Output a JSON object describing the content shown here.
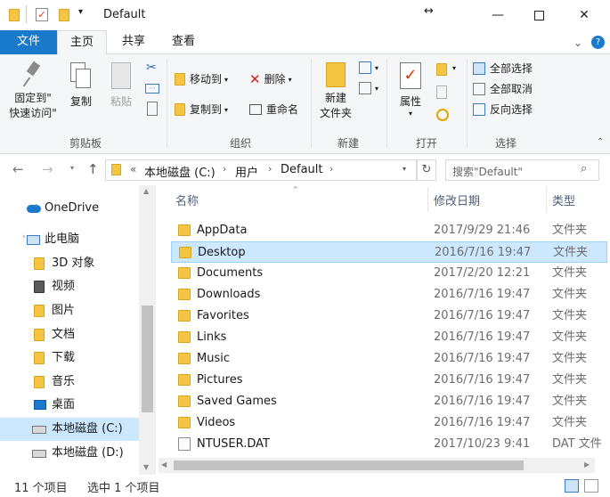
{
  "window": {
    "title": "Default"
  },
  "tabs": [
    "文件",
    "主页",
    "共享",
    "查看"
  ],
  "ribbon": {
    "clipboard": {
      "pin_l1": "固定到\"",
      "pin_l2": "快速访问\"",
      "copy": "复制",
      "paste": "粘贴",
      "group": "剪贴板"
    },
    "organize": {
      "move_to": "移动到",
      "copy_to": "复制到",
      "delete": "删除",
      "rename": "重命名",
      "group": "组织"
    },
    "new": {
      "new_folder_l1": "新建",
      "new_folder_l2": "文件夹",
      "group": "新建"
    },
    "open": {
      "properties": "属性",
      "group": "打开"
    },
    "select": {
      "select_all": "全部选择",
      "select_none": "全部取消",
      "invert": "反向选择",
      "group": "选择"
    }
  },
  "address": {
    "crumbs": [
      "本地磁盘 (C:)",
      "用户",
      "Default"
    ],
    "overflow": "«"
  },
  "search": {
    "placeholder": "搜索\"Default\""
  },
  "nav": {
    "items": [
      {
        "label": "OneDrive",
        "icon": "cloud-icon"
      },
      {
        "label": "此电脑",
        "icon": "computer-icon"
      },
      {
        "label": "3D 对象",
        "icon": "3d-objects-icon"
      },
      {
        "label": "视频",
        "icon": "video-icon"
      },
      {
        "label": "图片",
        "icon": "pictures-icon"
      },
      {
        "label": "文档",
        "icon": "documents-icon"
      },
      {
        "label": "下载",
        "icon": "downloads-icon"
      },
      {
        "label": "音乐",
        "icon": "music-icon"
      },
      {
        "label": "桌面",
        "icon": "desktop-icon"
      },
      {
        "label": "本地磁盘 (C:)",
        "icon": "drive-c-icon"
      },
      {
        "label": "本地磁盘 (D:)",
        "icon": "drive-d-icon"
      }
    ]
  },
  "columns": {
    "name": "名称",
    "modified": "修改日期",
    "type": "类型"
  },
  "files": [
    {
      "name": "AppData",
      "modified": "2017/9/29 21:46",
      "type": "文件夹"
    },
    {
      "name": "Desktop",
      "modified": "2016/7/16 19:47",
      "type": "文件夹"
    },
    {
      "name": "Documents",
      "modified": "2017/2/20 12:21",
      "type": "文件夹"
    },
    {
      "name": "Downloads",
      "modified": "2016/7/16 19:47",
      "type": "文件夹"
    },
    {
      "name": "Favorites",
      "modified": "2016/7/16 19:47",
      "type": "文件夹"
    },
    {
      "name": "Links",
      "modified": "2016/7/16 19:47",
      "type": "文件夹"
    },
    {
      "name": "Music",
      "modified": "2016/7/16 19:47",
      "type": "文件夹"
    },
    {
      "name": "Pictures",
      "modified": "2016/7/16 19:47",
      "type": "文件夹"
    },
    {
      "name": "Saved Games",
      "modified": "2016/7/16 19:47",
      "type": "文件夹"
    },
    {
      "name": "Videos",
      "modified": "2016/7/16 19:47",
      "type": "文件夹"
    },
    {
      "name": "NTUSER.DAT",
      "modified": "2017/10/23 9:41",
      "type": "DAT 文件"
    }
  ],
  "status": {
    "count": "11 个项目",
    "selected": "选中 1 个项目"
  },
  "colors": {
    "accent": "#1979ca",
    "selection": "#cce8ff",
    "folder": "#f4c542"
  }
}
